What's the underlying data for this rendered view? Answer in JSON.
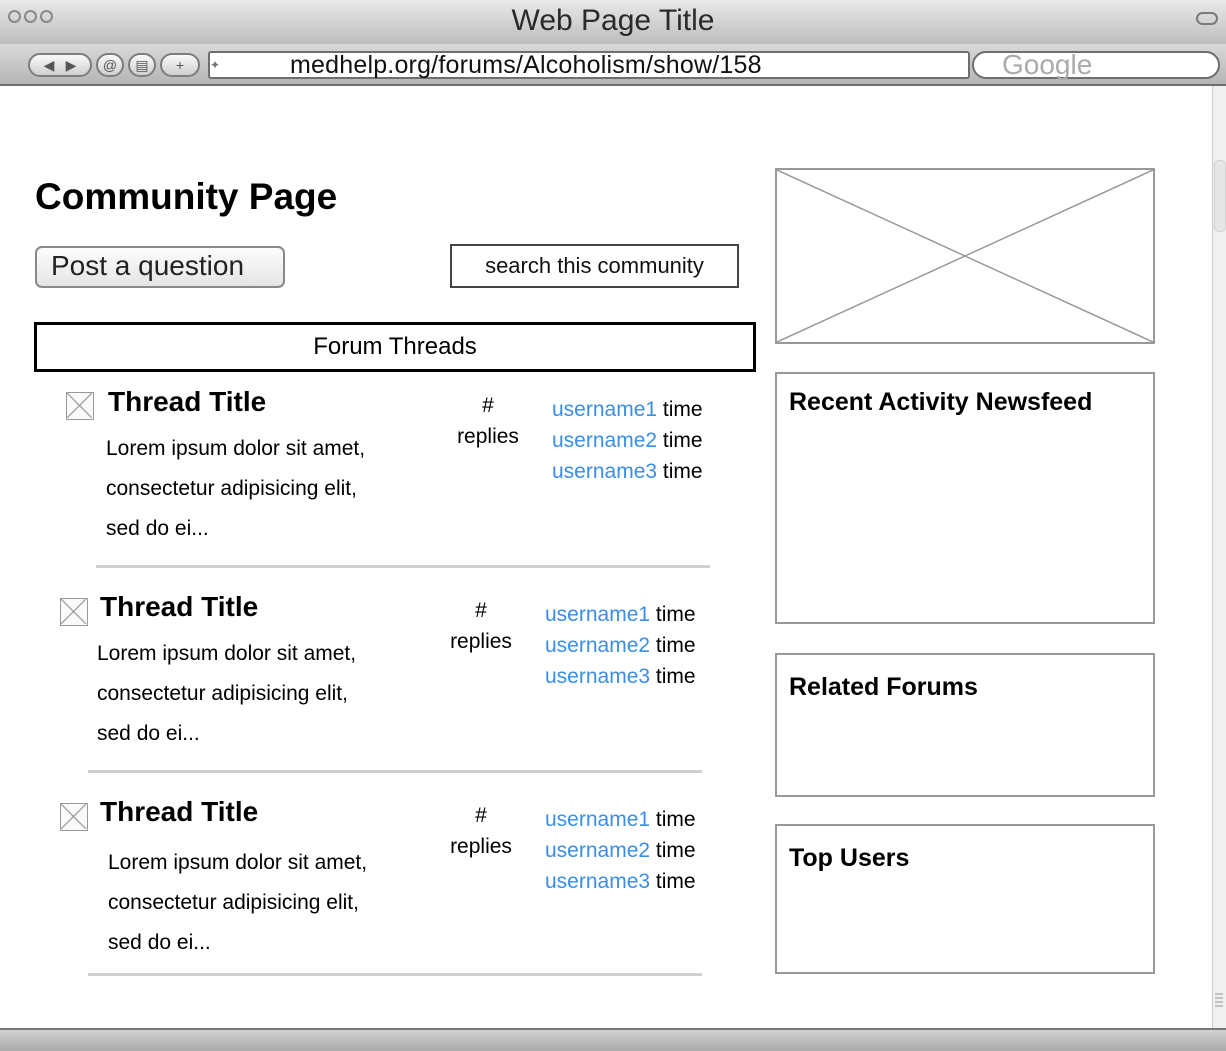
{
  "window": {
    "title": "Web Page Title",
    "url": "medhelp.org/forums/Alcoholism/show/158",
    "search_engine": "Google"
  },
  "page": {
    "title": "Community Page",
    "post_button": "Post a question",
    "search_placeholder": "search this community",
    "forum_header": "Forum Threads"
  },
  "threads": [
    {
      "title": "Thread Title",
      "body_lines": [
        "Lorem ipsum dolor sit amet,",
        "consectetur adipisicing elit,",
        "sed do ei..."
      ],
      "replies_top": "#",
      "replies_bottom": "replies",
      "users": [
        {
          "name": "username1",
          "time": "time"
        },
        {
          "name": "username2",
          "time": "time"
        },
        {
          "name": "username3",
          "time": "time"
        }
      ]
    },
    {
      "title": "Thread Title",
      "body_lines": [
        "Lorem ipsum dolor sit amet,",
        "consectetur adipisicing elit,",
        "sed do ei..."
      ],
      "replies_top": "#",
      "replies_bottom": "replies",
      "users": [
        {
          "name": "username1",
          "time": "time"
        },
        {
          "name": "username2",
          "time": "time"
        },
        {
          "name": "username3",
          "time": "time"
        }
      ]
    },
    {
      "title": "Thread Title",
      "body_lines": [
        "Lorem ipsum dolor sit amet,",
        "consectetur adipisicing elit,",
        "sed do ei..."
      ],
      "replies_top": "#",
      "replies_bottom": "replies",
      "users": [
        {
          "name": "username1",
          "time": "time"
        },
        {
          "name": "username2",
          "time": "time"
        },
        {
          "name": "username3",
          "time": "time"
        }
      ]
    }
  ],
  "sidebar": {
    "newsfeed_title": "Recent Activity Newsfeed",
    "related_title": "Related Forums",
    "top_users_title": "Top Users"
  },
  "colors": {
    "link": "#3a8ee6"
  }
}
